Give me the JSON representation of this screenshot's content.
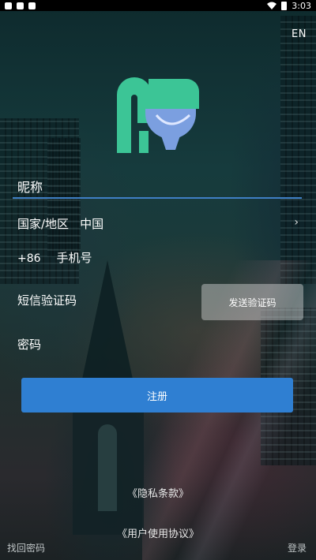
{
  "status_bar": {
    "time": "3:03"
  },
  "header": {
    "language_toggle": "EN"
  },
  "form": {
    "nickname_placeholder": "昵称",
    "region_label": "国家/地区",
    "region_value": "中国",
    "phone_code": "+86",
    "phone_placeholder": "手机号",
    "sms_code_placeholder": "短信验证码",
    "send_code_label": "发送验证码",
    "password_placeholder": "密码",
    "register_label": "注册"
  },
  "links": {
    "privacy": "《隐私条款》",
    "user_agreement": "《用户使用协议》",
    "forgot_password": "找回密码",
    "login": "登录"
  },
  "colors": {
    "accent": "#2f7fd2",
    "logo_green": "#3cc596",
    "logo_blue": "#7b9fe0"
  }
}
